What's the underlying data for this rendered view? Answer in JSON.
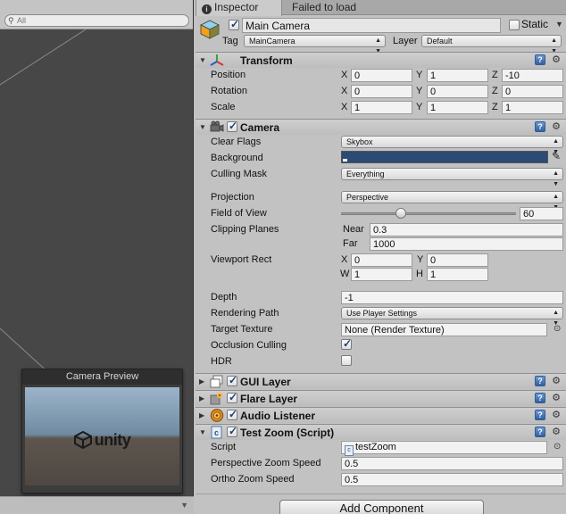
{
  "scene": {
    "search_placeholder": "All",
    "search_icon": "search-icon",
    "preview_title": "Camera Preview",
    "logo_text": "unity"
  },
  "tabs": [
    {
      "label": "Inspector",
      "icon": "info-icon"
    },
    {
      "label": "Failed to load"
    }
  ],
  "gameobject": {
    "name": "Main Camera",
    "active": true,
    "static_label": "Static",
    "static": false,
    "tag_label": "Tag",
    "tag": "MainCamera",
    "layer_label": "Layer",
    "layer": "Default"
  },
  "transform": {
    "title": "Transform",
    "position_label": "Position",
    "rotation_label": "Rotation",
    "scale_label": "Scale",
    "axes": [
      "X",
      "Y",
      "Z"
    ],
    "position": [
      "0",
      "1",
      "-10"
    ],
    "rotation": [
      "0",
      "0",
      "0"
    ],
    "scale": [
      "1",
      "1",
      "1"
    ]
  },
  "camera": {
    "title": "Camera",
    "enabled": true,
    "clear_flags_label": "Clear Flags",
    "clear_flags": "Skybox",
    "background_label": "Background",
    "background_color": "#2b4b74",
    "culling_mask_label": "Culling Mask",
    "culling_mask": "Everything",
    "projection_label": "Projection",
    "projection": "Perspective",
    "fov_label": "Field of View",
    "fov": "60",
    "fov_fraction": 0.333,
    "clipping_label": "Clipping Planes",
    "near_label": "Near",
    "near": "0.3",
    "far_label": "Far",
    "far": "1000",
    "viewport_label": "Viewport Rect",
    "viewport_axes": [
      "X",
      "Y",
      "W",
      "H"
    ],
    "viewport_values": [
      "0",
      "0",
      "1",
      "1"
    ],
    "depth_label": "Depth",
    "depth": "-1",
    "rendering_path_label": "Rendering Path",
    "rendering_path": "Use Player Settings",
    "target_texture_label": "Target Texture",
    "target_texture": "None (Render Texture)",
    "occlusion_label": "Occlusion Culling",
    "occlusion": true,
    "hdr_label": "HDR",
    "hdr": false
  },
  "components": [
    {
      "title": "GUI Layer",
      "enabled": true
    },
    {
      "title": "Flare Layer",
      "enabled": true
    },
    {
      "title": "Audio Listener",
      "enabled": true
    }
  ],
  "test_zoom": {
    "title": "Test Zoom (Script)",
    "enabled": true,
    "script_label": "Script",
    "script": "testZoom",
    "persp_label": "Perspective Zoom Speed",
    "persp": "0.5",
    "ortho_label": "Ortho Zoom Speed",
    "ortho": "0.5"
  },
  "add_component_label": "Add Component",
  "colors": {
    "panel_bg": "#c2c2c2",
    "scene_bg": "#474747",
    "help_icon": "#335f9c"
  }
}
